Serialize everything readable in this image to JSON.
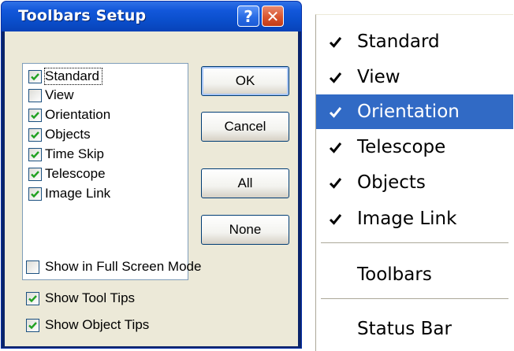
{
  "dialog": {
    "title": "Toolbars Setup",
    "help_glyph": "?",
    "close_glyph": "✕",
    "toolbar_list": [
      {
        "label": "Standard",
        "checked": true,
        "focused": true
      },
      {
        "label": "View",
        "checked": false
      },
      {
        "label": "Orientation",
        "checked": true
      },
      {
        "label": "Objects",
        "checked": true
      },
      {
        "label": "Time Skip",
        "checked": true
      },
      {
        "label": "Telescope",
        "checked": true
      },
      {
        "label": "Image Link",
        "checked": true
      }
    ],
    "buttons": {
      "ok": "OK",
      "cancel": "Cancel",
      "all": "All",
      "none": "None"
    },
    "options": [
      {
        "label": "Show in Full Screen Mode",
        "checked": false
      },
      {
        "label": "Show Tool Tips",
        "checked": true
      },
      {
        "label": "Show Object Tips",
        "checked": true
      }
    ]
  },
  "menu": {
    "toolbar_items": [
      {
        "label": "Standard",
        "checked": true
      },
      {
        "label": "View",
        "checked": true
      },
      {
        "label": "Orientation",
        "checked": true,
        "highlighted": true
      },
      {
        "label": "Telescope",
        "checked": true
      },
      {
        "label": "Objects",
        "checked": true
      },
      {
        "label": "Image Link",
        "checked": true
      }
    ],
    "toolbars_item": "Toolbars",
    "status_bar_item": "Status Bar"
  },
  "colors": {
    "title_bar": "#0a4ecb",
    "dialog_face": "#ece9d8",
    "menu_highlight": "#316ac5",
    "checkbox_check": "#21a121"
  }
}
